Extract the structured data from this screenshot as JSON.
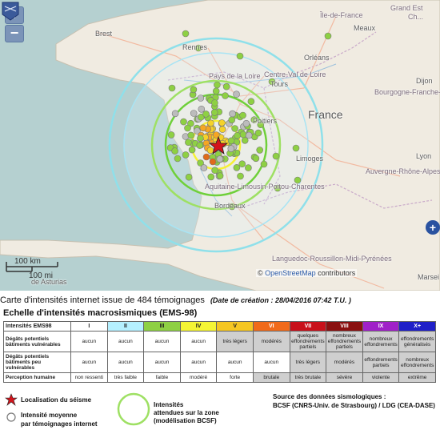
{
  "map": {
    "zoom_in": "+",
    "zoom_out": "−",
    "expand": "+",
    "places": {
      "brest": "Brest",
      "rennes": "Rennes",
      "ile_de_france": "Île-de-France",
      "grand_est": "Grand Est",
      "champagne": "Ch...",
      "meaux": "Meaux",
      "pays_loire": "Pays de la Loire",
      "orleans": "Orléans",
      "centre_val": "Centre-Val de Loire",
      "tours": "Tours",
      "bourgogne": "Bourgogne-Franche-Co...",
      "dijon": "Dijon",
      "france": "France",
      "poitiers": "Poitiers",
      "limoges": "Limoges",
      "auvergne": "Auvergne-Rhône-Alpes",
      "lyon": "Lyon",
      "aquitaine": "Aquitaine-Limousin-Poitou-Charentes",
      "bordeaux": "Bordeaux",
      "languedoc": "Languedoc-Roussillon-Midi-Pyrénées",
      "asturias": "de Asturias",
      "marseille": "Marsei"
    },
    "scale_km": "100 km",
    "scale_mi": "100 mi",
    "attribution_prefix": "©",
    "attribution_link": "OpenStreetMap",
    "attribution_suffix": "contributors",
    "logo_text": "BCSF",
    "intensity_colors": [
      "#8ed043",
      "#f5d22a",
      "#f5a623",
      "#e06a1a",
      "#bcbcbc"
    ]
  },
  "title": {
    "main": "Carte d'intensités internet issue de 484 témoignages",
    "date": "(Date de création : 28/04/2016 07:42 T.U. )"
  },
  "subtitle": "Echelle d'intensités macrosismiques (EMS-98)",
  "table": {
    "rows": [
      {
        "label": "Intensités EMS98",
        "cells": [
          "I",
          "II",
          "III",
          "IV",
          "V",
          "VI",
          "VII",
          "VIII",
          "IX",
          "X+"
        ]
      },
      {
        "label": "Dégâts potentiels bâtiments vulnérables",
        "cells": [
          "aucun",
          "aucun",
          "aucun",
          "aucun",
          "très légers",
          "modérés",
          "quelques effondrements partiels",
          "nombreux effondrements partiels",
          "nombreux effondrements",
          "effondrements généralisés"
        ]
      },
      {
        "label": "Dégâts potentiels bâtiments peu vulnérables",
        "cells": [
          "aucun",
          "aucun",
          "aucun",
          "aucun",
          "aucun",
          "aucun",
          "très légers",
          "modérés",
          "effondrements partiels",
          "nombreux effondrements"
        ]
      },
      {
        "label": "Perception humaine",
        "cells": [
          "non ressenti",
          "très faible",
          "faible",
          "modéré",
          "forte",
          "brutale",
          "très brutale",
          "sévère",
          "violente",
          "extrême"
        ]
      }
    ],
    "header_colors": [
      "#ffffff",
      "#b5f0ff",
      "#8ed043",
      "#f5f535",
      "#f5c623",
      "#f06a1a",
      "#c8101a",
      "#8a1010",
      "#a020c8",
      "#2020c8"
    ],
    "header_text_colors": [
      "#222",
      "#222",
      "#222",
      "#222",
      "#222",
      "#fff",
      "#fff",
      "#fff",
      "#fff",
      "#fff"
    ],
    "damage_bg": "#cfcfcf"
  },
  "legend": {
    "epicenter": "Localisation du séisme",
    "avg_line1": "Intensité moyenne",
    "avg_line2": "par témoignages internet",
    "zone_line1": "Intensités",
    "zone_line2": "attendues sur la zone",
    "zone_line3": "(modélisation BCSF)",
    "source_line1": "Source des données sismologiques :",
    "source_line2": "BCSF (CNRS-Univ. de Strasbourg) / LDG (CEA-DASE)"
  }
}
